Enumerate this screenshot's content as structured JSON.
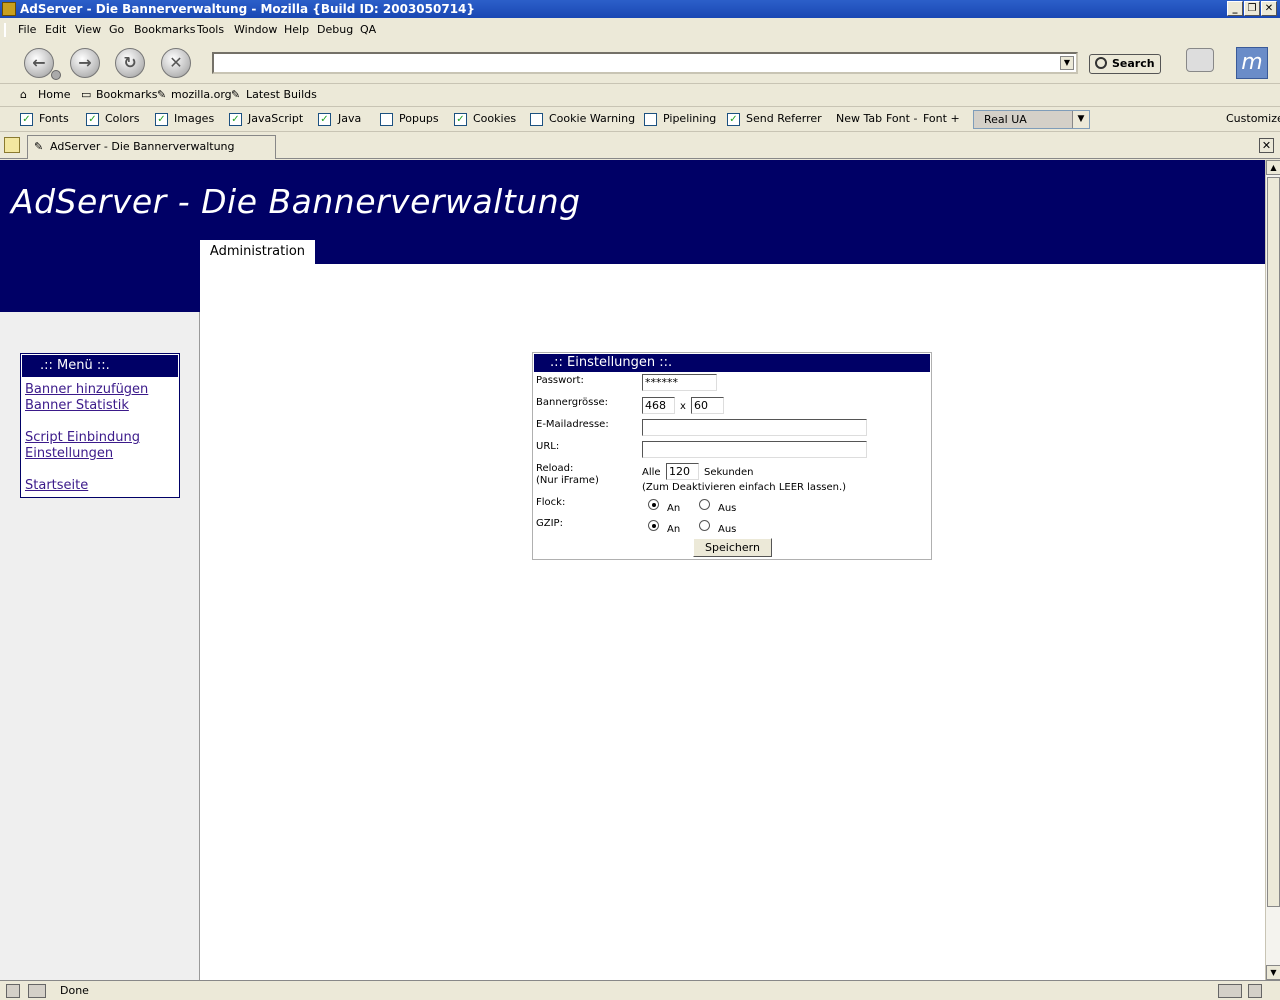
{
  "window": {
    "title": "AdServer - Die Bannerverwaltung - Mozilla {Build ID: 2003050714}",
    "min_label": "_",
    "max_label": "❐",
    "close_label": "✕"
  },
  "menu": [
    "File",
    "Edit",
    "View",
    "Go",
    "Bookmarks",
    "Tools",
    "Window",
    "Help",
    "Debug",
    "QA"
  ],
  "nav": {
    "url_value": "",
    "search_label": "Search"
  },
  "personal": {
    "home": "Home",
    "bookmarks": "Bookmarks",
    "mozilla": "mozilla.org",
    "latest": "Latest Builds"
  },
  "prefbar": {
    "checks": [
      {
        "label": "Fonts",
        "checked": true
      },
      {
        "label": "Colors",
        "checked": true
      },
      {
        "label": "Images",
        "checked": true
      },
      {
        "label": "JavaScript",
        "checked": true
      },
      {
        "label": "Java",
        "checked": true
      },
      {
        "label": "Popups",
        "checked": false
      },
      {
        "label": "Cookies",
        "checked": true
      },
      {
        "label": "Cookie Warning",
        "checked": false
      },
      {
        "label": "Pipelining",
        "checked": false
      },
      {
        "label": "Send Referrer",
        "checked": true
      }
    ],
    "new_tab": "New Tab",
    "font_minus": "Font -",
    "font_plus": "Font +",
    "ua_selected": "Real UA",
    "customize": "Customize"
  },
  "tab": {
    "title": "AdServer - Die Bannerverwaltung"
  },
  "page": {
    "site_title": "AdServer - Die Bannerverwaltung",
    "admin_tab": "Administration",
    "menu_heading": ".:: Menü ::.",
    "menu_links": [
      "Banner hinzufügen",
      "Banner Statistik",
      "Script Einbindung",
      "Einstellungen",
      "Startseite"
    ],
    "settings": {
      "heading": ".:: Einstellungen ::.",
      "passwort_label": "Passwort:",
      "passwort_value": "******",
      "bannergroesse_label": "Bannergrösse:",
      "width_value": "468",
      "x_sep": "x",
      "height_value": "60",
      "email_label": "E-Mailadresse:",
      "email_value": "",
      "url_label": "URL:",
      "url_value": "",
      "reload_label": "Reload:",
      "reload_sub": "(Nur iFrame)",
      "alle": "Alle",
      "reload_value": "120",
      "sekunden": "Sekunden",
      "reload_hint": "(Zum Deaktivieren einfach LEER lassen.)",
      "flock_label": "Flock:",
      "gzip_label": "GZIP:",
      "an": "An",
      "aus": "Aus",
      "save_label": "Speichern"
    }
  },
  "status": {
    "text": "Done"
  }
}
